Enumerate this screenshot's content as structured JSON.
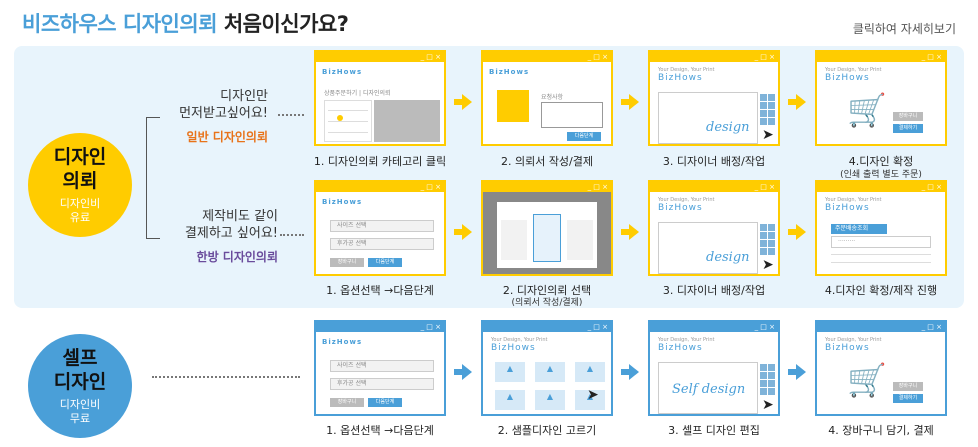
{
  "header": {
    "title_blue": "비즈하우스 디자인의뢰",
    "title_dark": "처음이신가요?",
    "more_link": "클릭하여 자세히보기"
  },
  "design_request": {
    "circle_title_1": "디자인",
    "circle_title_2": "의뢰",
    "circle_sub_1": "디자인비",
    "circle_sub_2": "유료",
    "general": {
      "question_1": "디자인만",
      "question_2": "먼저받고싶어요!",
      "name": "일반 디자인의뢰",
      "name_color": "#e8731a",
      "steps": [
        {
          "label": "1. 디자인의뢰 카테고리 클릭"
        },
        {
          "label": "2. 의뢰서 작성/결제"
        },
        {
          "label": "3. 디자이너 배정/작업"
        },
        {
          "label": "4.디자인 확정",
          "sub": "(인쇄 출력 별도 주문)"
        }
      ]
    },
    "onestop": {
      "question_1": "제작비도 같이",
      "question_2": "결제하고 싶어요!",
      "name": "한방 디자인의뢰",
      "name_color": "#6a4c9c",
      "steps": [
        {
          "label": "1. 옵션선택 →다음단계"
        },
        {
          "label": "2. 디자인의뢰 선택",
          "sub": "(의뢰서 작성/결제)"
        },
        {
          "label": "3. 디자이너 배정/작업"
        },
        {
          "label": "4.디자인 확정/제작 진행"
        }
      ]
    }
  },
  "self_design": {
    "circle_title_1": "셀프",
    "circle_title_2": "디자인",
    "circle_sub_1": "디자인비",
    "circle_sub_2": "무료",
    "steps": [
      {
        "label": "1. 옵션선택 →다음단계"
      },
      {
        "label": "2. 샘플디자인 고르기"
      },
      {
        "label": "3. 셀프 디자인 편집"
      },
      {
        "label": "4. 장바구니 담기, 결제"
      }
    ]
  },
  "mock": {
    "logo": "BizHows",
    "logo_tag": "Your Design, Your Print",
    "window_controls": "_ □ ×",
    "menu_1": "상품주문하기",
    "menu_2": "디자인의뢰",
    "request_form": "요청사항",
    "next_button": "다음단계",
    "option_1": "사이즈 선택",
    "option_2": "후가공 선택",
    "btn_gray": "장바구니",
    "design_word": "design",
    "self_design_word": "Self design",
    "order_label": "주문배송조회",
    "order_value": "·········",
    "confirm_btn": "결제하기",
    "cart_btn": "장바구니",
    "pick_btn": "선택하기",
    "accent_yellow": "#ffcc00",
    "accent_blue": "#4a9fd8"
  }
}
